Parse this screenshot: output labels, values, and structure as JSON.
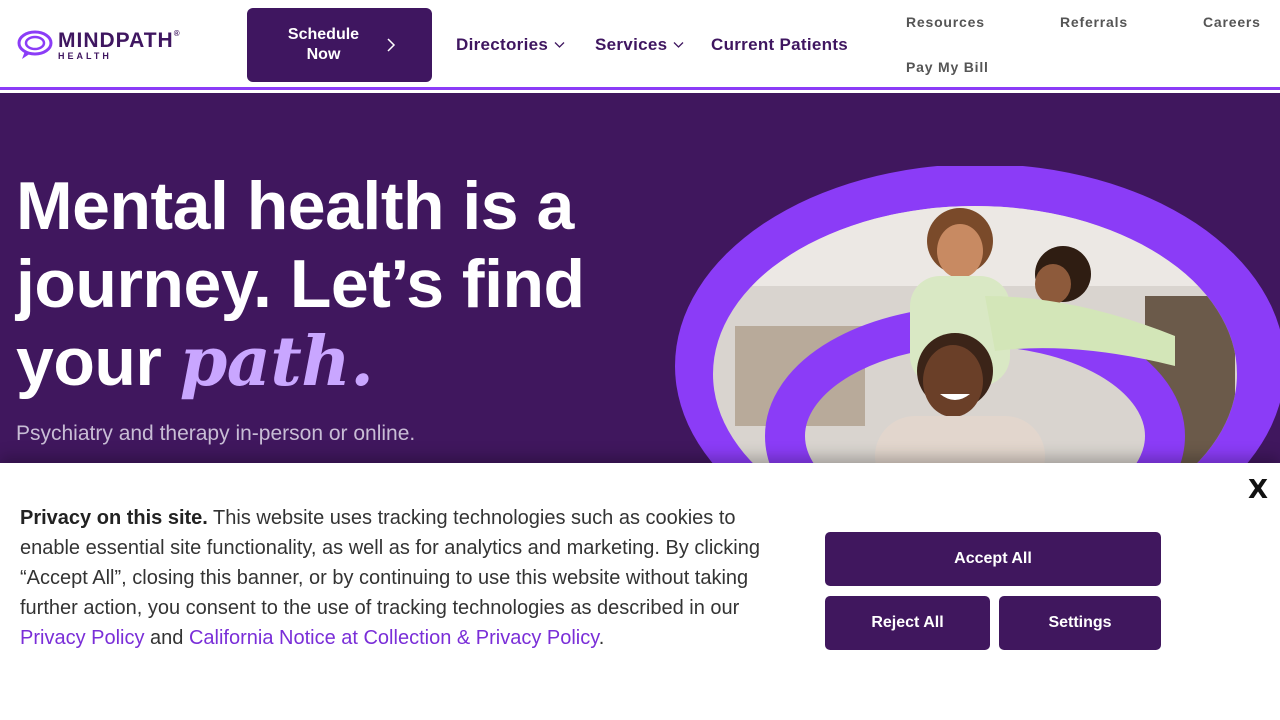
{
  "brand": {
    "name": "MINDPATH",
    "registered": "®",
    "subtitle": "HEALTH",
    "accent": "#8b3cf7",
    "primary": "#40175e",
    "highlight": "#c9a6ff"
  },
  "header": {
    "schedule_label": "Schedule Now",
    "nav": [
      {
        "label": "Directories",
        "has_dropdown": true,
        "icon": "chevron-down-icon"
      },
      {
        "label": "Services",
        "has_dropdown": true,
        "icon": "chevron-down-icon"
      },
      {
        "label": "Current Patients",
        "has_dropdown": false
      }
    ],
    "utility": [
      "Resources",
      "Referrals",
      "Careers",
      "Pay My Bill"
    ]
  },
  "hero": {
    "title_line1": "Mental health is a",
    "title_line2": "journey. Let’s find",
    "title_line3_prefix": "your ",
    "title_highlight": "path",
    "title_end": ".",
    "subtitle": "Psychiatry and therapy in-person or online.",
    "image_icon": "family-photo"
  },
  "cookie": {
    "heading": "Privacy on this site.",
    "body": " This website uses tracking technologies such as cookies to enable essential site functionality, as well as for analytics and marketing. By clicking “Accept All”, closing this banner, or by continuing to use this website without taking further action, you consent to the use of tracking technologies as described in our ",
    "link1": "Privacy Policy",
    "and": " and ",
    "link2": "California Notice at Collection & Privacy Policy",
    "end": ".",
    "accept": "Accept All",
    "reject": "Reject All",
    "settings": "Settings",
    "close": "X"
  }
}
